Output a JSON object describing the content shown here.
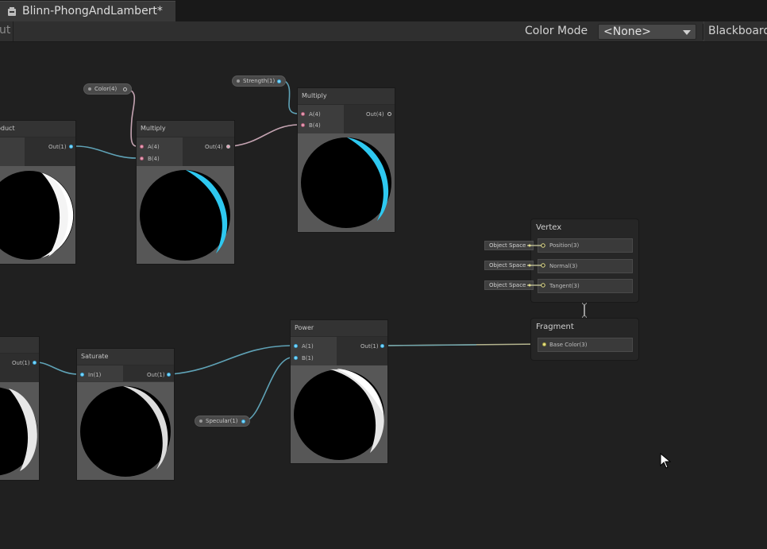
{
  "tab": {
    "title": "Blinn-PhongAndLambert*",
    "icon": "graph-asset-icon"
  },
  "toolbar": {
    "left_button_fragment": "ut",
    "color_mode_label": "Color Mode",
    "color_mode_value": "<None>",
    "blackboard_label": "Blackboard"
  },
  "nodes": {
    "product": {
      "title": "oduct",
      "out": "Out(1)"
    },
    "multiply1": {
      "title": "Multiply",
      "in_a": "A(4)",
      "in_b": "B(4)",
      "out": "Out(4)"
    },
    "multiply2": {
      "title": "Multiply",
      "in_a": "A(4)",
      "in_b": "B(4)",
      "out": "Out(4)"
    },
    "left_bottom": {
      "out": "Out(1)"
    },
    "saturate": {
      "title": "Saturate",
      "in": "In(1)",
      "out": "Out(1)"
    },
    "power": {
      "title": "Power",
      "in_a": "A(1)",
      "in_b": "B(1)",
      "out": "Out(1)"
    }
  },
  "properties": {
    "color": "Color(4)",
    "strength": "Strength(1)",
    "specular": "Specular(1)"
  },
  "vertex": {
    "title": "Vertex",
    "slots": [
      "Position(3)",
      "Normal(3)",
      "Tangent(3)"
    ],
    "space_label": "Object Space"
  },
  "fragment": {
    "title": "Fragment",
    "slots": [
      "Base Color(3)"
    ]
  },
  "colors": {
    "wire_float": "#5fa2b6",
    "wire_vec4": "#c4a3b1",
    "wire_vec3": "#b4b48e",
    "highlight_cyan": "#2ec8f0"
  }
}
